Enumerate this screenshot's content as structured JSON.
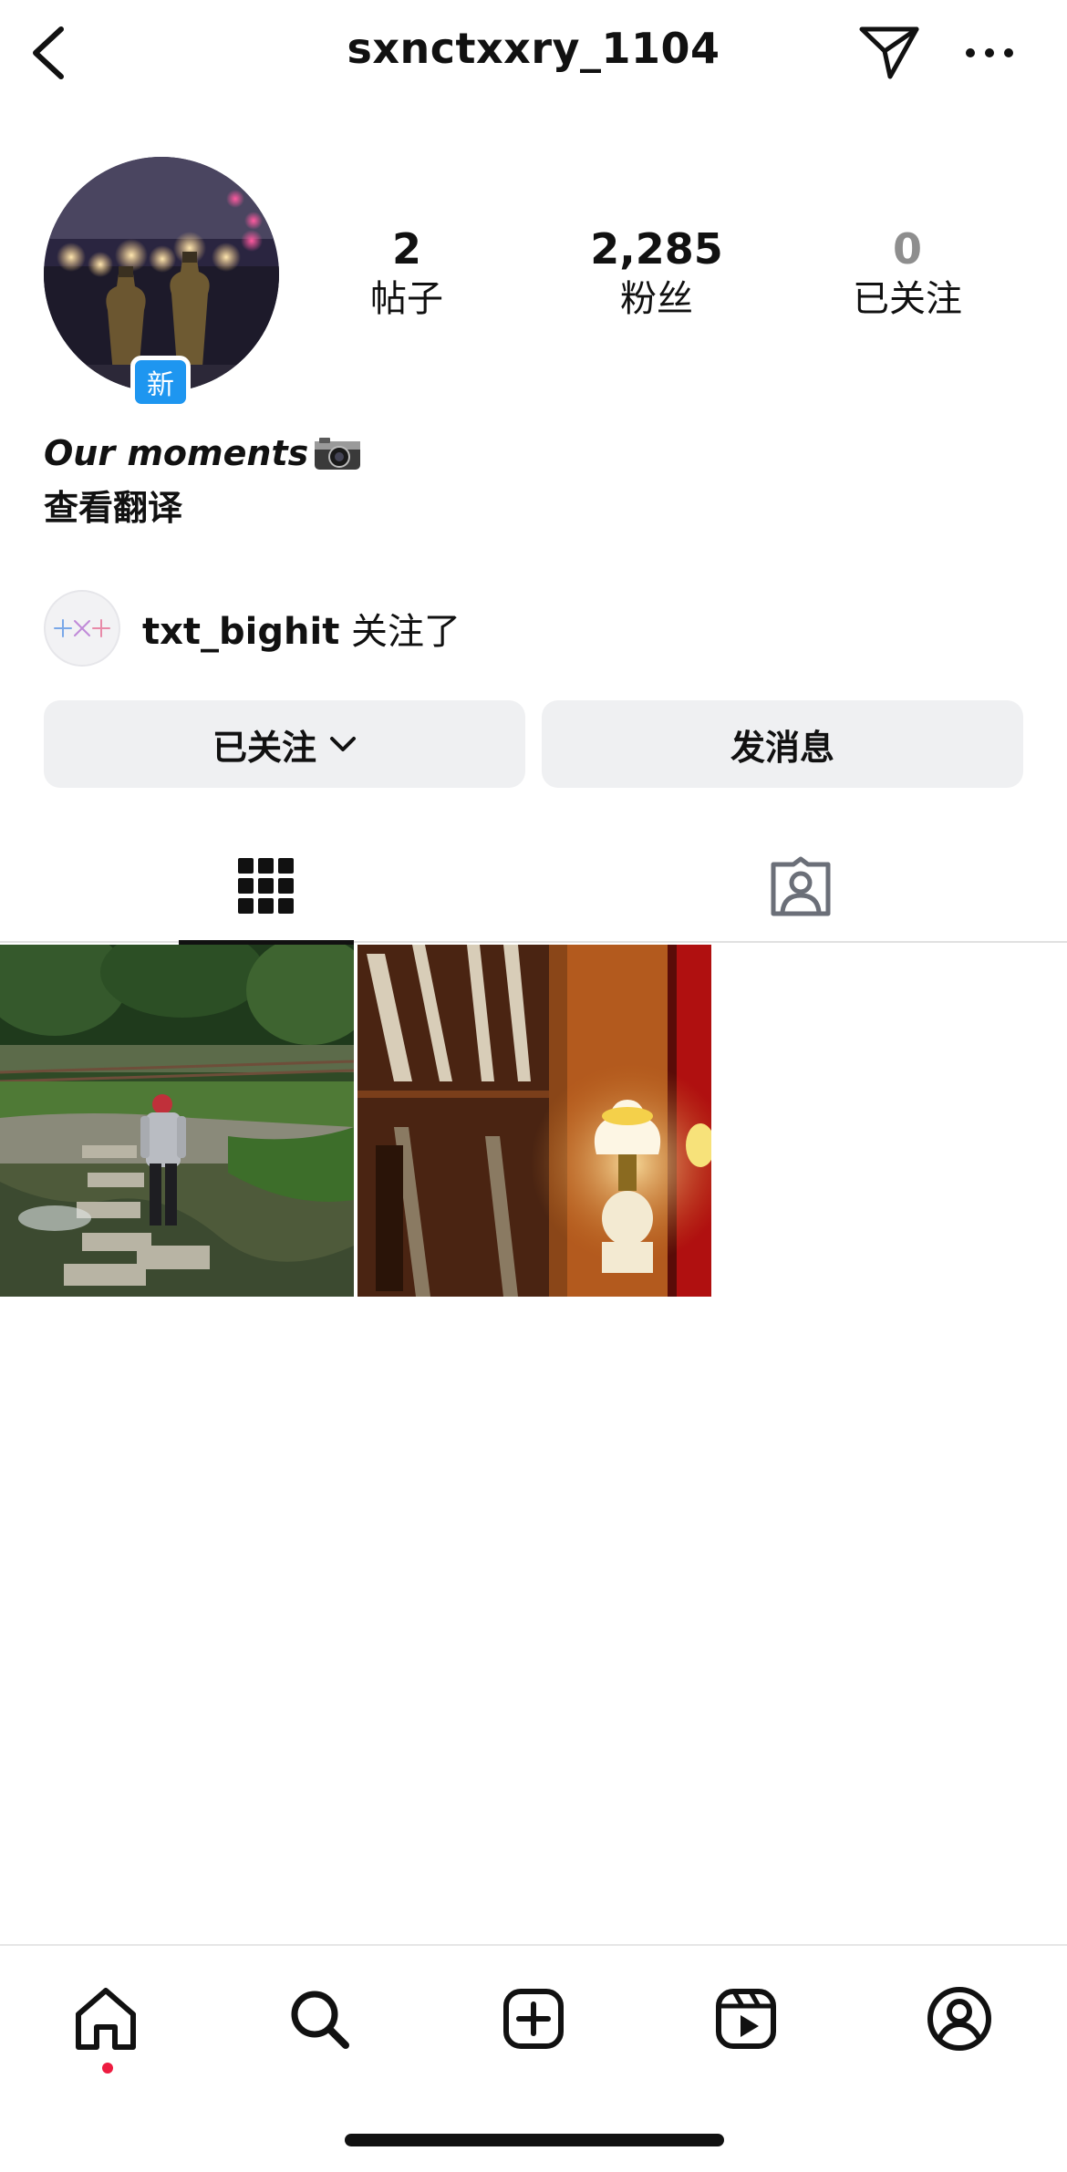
{
  "header": {
    "username": "sxnctxxry_1104"
  },
  "profile": {
    "badge": "新",
    "stats": [
      {
        "value": "2",
        "label": "帖子"
      },
      {
        "value": "2,285",
        "label": "粉丝"
      },
      {
        "value": "0",
        "label": "已关注"
      }
    ],
    "bio_name": "Our moments",
    "bio_emoji": "camera-icon",
    "translate": "查看翻译"
  },
  "followed_by": {
    "username": "txt_bighit",
    "suffix": "关注了"
  },
  "actions": {
    "following": "已关注",
    "message": "发消息"
  },
  "tabs": [
    "grid-icon",
    "tagged-icon"
  ],
  "posts": [
    {
      "subject": "person-walking-stepping-stones"
    },
    {
      "subject": "records-and-lamp"
    }
  ],
  "nav": [
    "home-icon",
    "search-icon",
    "create-icon",
    "reels-icon",
    "profile-icon"
  ],
  "colors": {
    "badge": "#1e96f0",
    "button_bg": "#eff0f2",
    "notification_dot": "#ed1c40",
    "muted": "#8e8e8e"
  }
}
